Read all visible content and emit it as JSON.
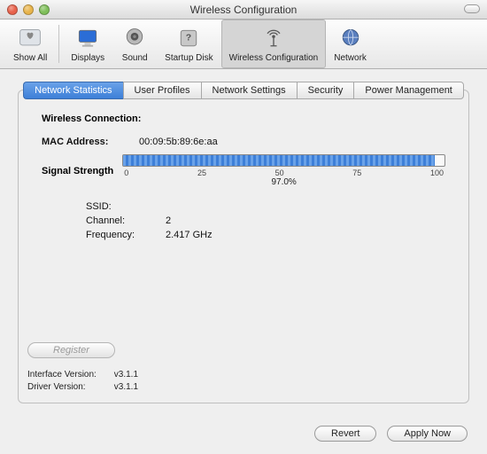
{
  "window": {
    "title": "Wireless Configuration"
  },
  "toolbar": {
    "show_all": "Show All",
    "displays": "Displays",
    "sound": "Sound",
    "startup_disk": "Startup Disk",
    "wireless_config": "Wireless Configuration",
    "network": "Network"
  },
  "tabs": {
    "network_statistics": "Network Statistics",
    "user_profiles": "User Profiles",
    "network_settings": "Network Settings",
    "security": "Security",
    "power_management": "Power Management"
  },
  "panel": {
    "heading": "Wireless Connection:",
    "mac_label": "MAC Address:",
    "mac_value": "00:09:5b:89:6e:aa",
    "signal_label": "Signal Strength",
    "signal_percent_text": "97.0%",
    "signal_percent_value": 97.0,
    "ticks": {
      "t0": "0",
      "t25": "25",
      "t50": "50",
      "t75": "75",
      "t100": "100"
    },
    "ssid_label": "SSID:",
    "ssid_value": "",
    "channel_label": "Channel:",
    "channel_value": "2",
    "freq_label": "Frequency:",
    "freq_value": "2.417 GHz",
    "register": "Register",
    "iface_ver_label": "Interface Version:",
    "iface_ver_value": "v3.1.1",
    "driver_ver_label": "Driver Version:",
    "driver_ver_value": "v3.1.1"
  },
  "buttons": {
    "revert": "Revert",
    "apply": "Apply Now"
  }
}
